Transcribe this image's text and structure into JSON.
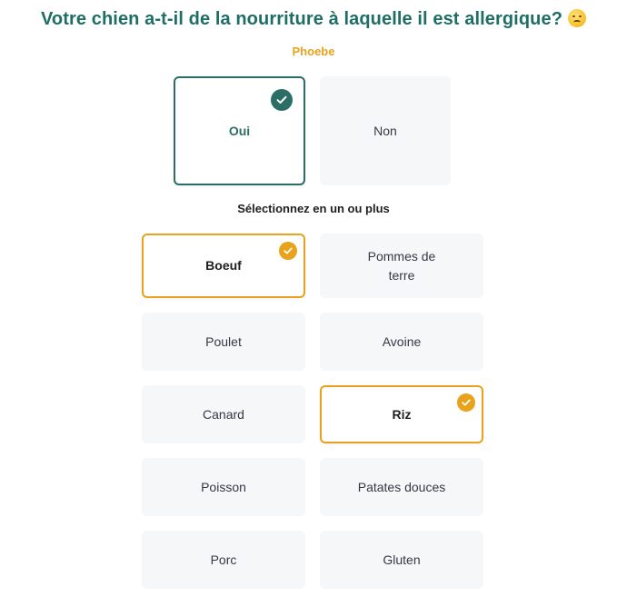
{
  "question": {
    "title": "Votre chien a-t-il de la nourriture à laquelle il est allergique?",
    "emoji": "sad-pleading-face",
    "pet_name": "Phoebe"
  },
  "yes_no": {
    "options": [
      {
        "label": "Oui",
        "selected": true
      },
      {
        "label": "Non",
        "selected": false
      }
    ]
  },
  "foods": {
    "instruction": "Sélectionnez en un ou plus",
    "options": [
      {
        "label": "Boeuf",
        "selected": true
      },
      {
        "label": "Pommes de terre",
        "selected": false
      },
      {
        "label": "Poulet",
        "selected": false
      },
      {
        "label": "Avoine",
        "selected": false
      },
      {
        "label": "Canard",
        "selected": false
      },
      {
        "label": "Riz",
        "selected": true
      },
      {
        "label": "Poisson",
        "selected": false
      },
      {
        "label": "Patates douces",
        "selected": false
      },
      {
        "label": "Porc",
        "selected": false
      },
      {
        "label": "Gluten",
        "selected": false
      }
    ]
  },
  "colors": {
    "title": "#1f6e66",
    "accent_green": "#2b6e66",
    "accent_orange": "#e8a21b",
    "card_background": "#f6f7f9"
  },
  "icons": {
    "selected_check": "check-circle-icon"
  }
}
